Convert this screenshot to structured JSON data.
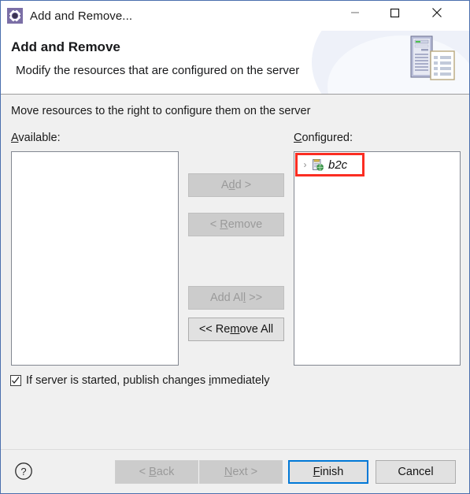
{
  "window": {
    "title": "Add and Remove...",
    "title_icon": "gear-icon",
    "controls": {
      "minimize": "minimize-icon",
      "maximize": "maximize-icon",
      "close": "close-icon"
    }
  },
  "header": {
    "title": "Add and Remove",
    "description": "Modify the resources that are configured on the server",
    "icon": "server-and-document-icon"
  },
  "main": {
    "intro": "Move resources to the right to configure them on the server",
    "available": {
      "label_pre": "A",
      "label_mnemonic": "",
      "label_post": "vailable:",
      "items": []
    },
    "configured": {
      "label_pre": "",
      "label_mnemonic": "C",
      "label_post": "onfigured:",
      "items": [
        {
          "twisty": "›",
          "icon": "web-module-icon",
          "label": "b2c",
          "highlight_color": "#fb2d22"
        }
      ]
    },
    "transfer_buttons": [
      {
        "pre": "A",
        "mn": "d",
        "post": "d >",
        "enabled": false,
        "name": "add-button"
      },
      {
        "pre": "< ",
        "mn": "R",
        "post": "emove",
        "enabled": false,
        "name": "remove-button"
      },
      {
        "pre": "Add Al",
        "mn": "l",
        "post": " >>",
        "enabled": false,
        "name": "add-all-button"
      },
      {
        "pre": "<< Re",
        "mn": "m",
        "post": "ove All",
        "enabled": true,
        "name": "remove-all-button"
      }
    ],
    "publish_checkbox": {
      "checked": true,
      "pre": "If server is started, publish changes ",
      "mn": "i",
      "post": "mmediately"
    }
  },
  "footer": {
    "help": "?",
    "buttons": [
      {
        "pre": "< ",
        "mn": "B",
        "post": "ack",
        "enabled": false,
        "default": false,
        "name": "back-button"
      },
      {
        "pre": "",
        "mn": "N",
        "post": "ext >",
        "enabled": false,
        "default": false,
        "name": "next-button"
      },
      {
        "pre": "",
        "mn": "F",
        "post": "inish",
        "enabled": true,
        "default": true,
        "name": "finish-button"
      },
      {
        "pre": "Cancel",
        "mn": "",
        "post": "",
        "enabled": true,
        "default": false,
        "name": "cancel-button"
      }
    ]
  },
  "colors": {
    "accent": "#0078d7",
    "highlight": "#fb2d22",
    "window_border": "#4a6fae",
    "dialog_bg": "#f0f0f0"
  }
}
